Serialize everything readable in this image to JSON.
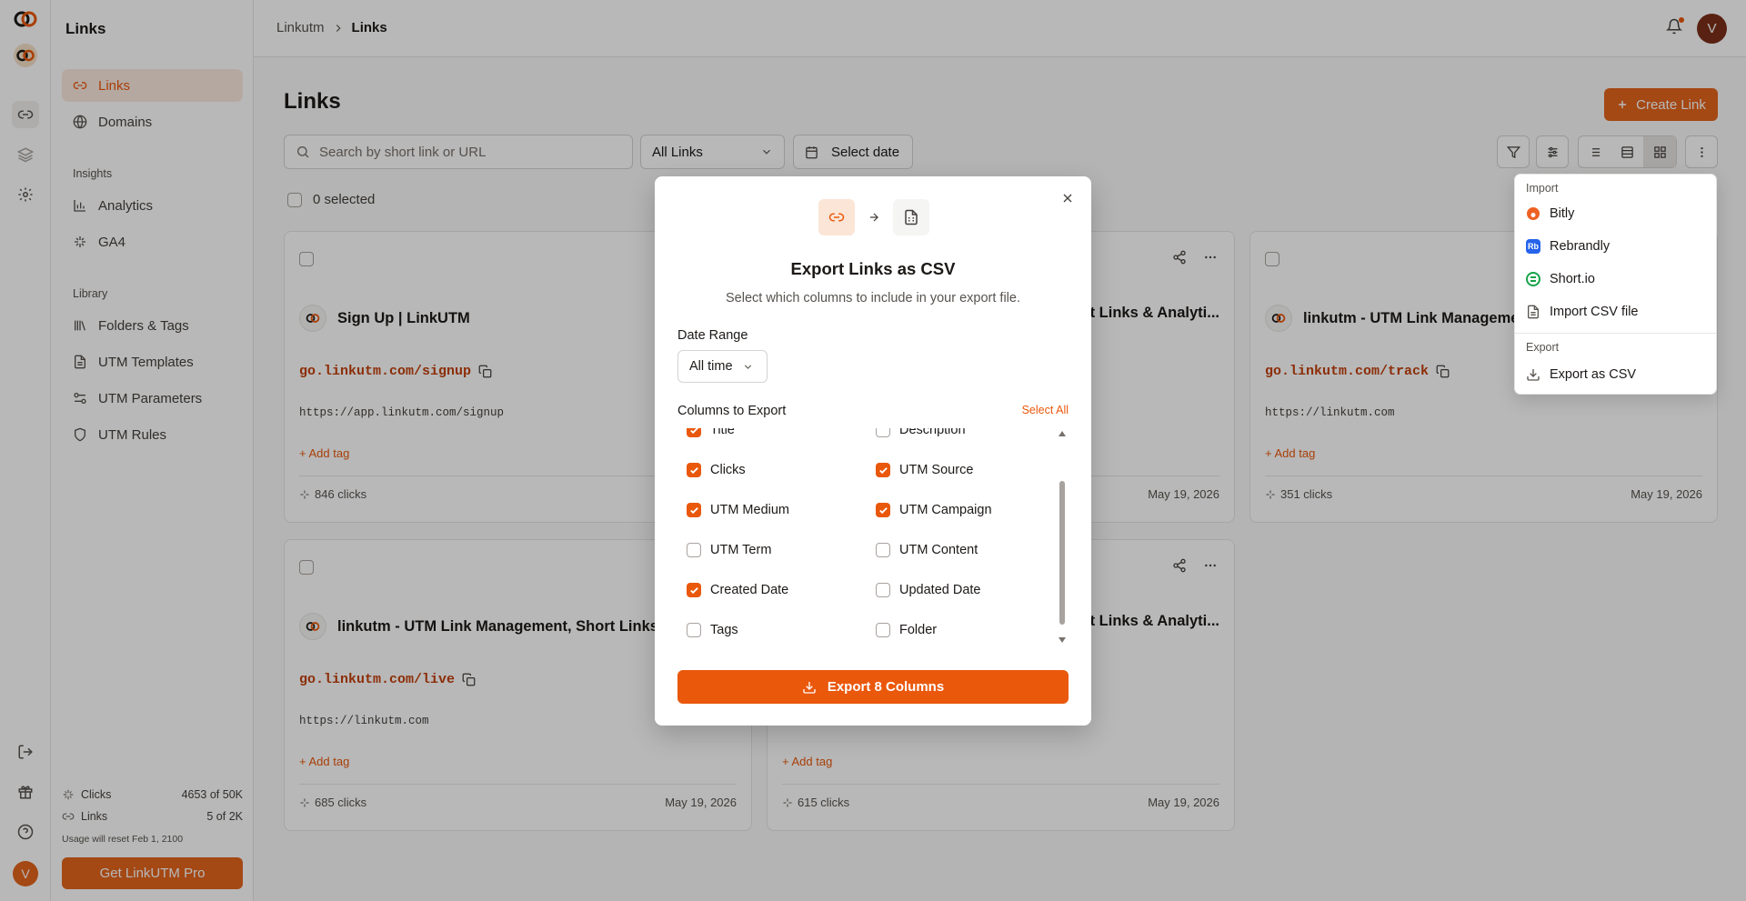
{
  "colors": {
    "accent": "#ea580c",
    "accent_button": "#e3651d",
    "avatar": "#7a2e18"
  },
  "sidebar": {
    "title": "Links",
    "items": [
      {
        "label": "Links",
        "icon": "link-icon"
      },
      {
        "label": "Domains",
        "icon": "globe-icon"
      }
    ],
    "insights_label": "Insights",
    "insights": [
      {
        "label": "Analytics",
        "icon": "bar-chart-icon"
      },
      {
        "label": "GA4",
        "icon": "sparkle-icon"
      }
    ],
    "library_label": "Library",
    "library": [
      {
        "label": "Folders & Tags",
        "icon": "library-icon"
      },
      {
        "label": "UTM Templates",
        "icon": "document-icon"
      },
      {
        "label": "UTM Parameters",
        "icon": "parameters-icon"
      },
      {
        "label": "UTM Rules",
        "icon": "shield-icon"
      }
    ],
    "usage": [
      {
        "label": "Clicks",
        "value": "4653 of 50K"
      },
      {
        "label": "Links",
        "value": "5 of 2K"
      }
    ],
    "reset_note": "Usage will reset Feb 1, 2100",
    "pro_button": "Get LinkUTM Pro"
  },
  "rail": {
    "avatar_letter": "V"
  },
  "header": {
    "breadcrumb": [
      "Linkutm",
      "Links"
    ],
    "avatar_letter": "V"
  },
  "main": {
    "title": "Links",
    "create_button": "Create Link",
    "search_placeholder": "Search by short link or URL",
    "filter_value": "All Links",
    "date_button": "Select date",
    "selected_text": "0 selected"
  },
  "cards": [
    {
      "title": "Sign Up | LinkUTM",
      "short": "go.linkutm.com/signup",
      "dest": "https://app.linkutm.com/signup",
      "add_tag": "+ Add tag",
      "clicks": "846 clicks",
      "date": ""
    },
    {
      "title": "t Links & Analyti...",
      "short": "",
      "dest": "",
      "add_tag": "",
      "clicks": "",
      "date": "May 19, 2026"
    },
    {
      "title": "linkutm - UTM Link Manageme",
      "short": "go.linkutm.com/track",
      "dest": "https://linkutm.com",
      "add_tag": "+ Add tag",
      "clicks": "351 clicks",
      "date": "May 19, 2026"
    },
    {
      "title": "linkutm - UTM Link Management, Short Links",
      "short": "go.linkutm.com/live",
      "dest": "https://linkutm.com",
      "add_tag": "+ Add tag",
      "clicks": "685 clicks",
      "date": "May 19, 2026"
    },
    {
      "title": "t Links & Analyti...",
      "short": "",
      "dest": "",
      "add_tag": "+ Add tag",
      "clicks": "615 clicks",
      "date": "May 19, 2026"
    }
  ],
  "modal": {
    "title": "Export Links as CSV",
    "subtitle": "Select which columns to include in your export file.",
    "date_range_label": "Date Range",
    "date_range_value": "All time",
    "columns_label": "Columns to Export",
    "select_all": "Select All",
    "columns": [
      {
        "label": "Title",
        "checked": true
      },
      {
        "label": "Description",
        "checked": false
      },
      {
        "label": "Clicks",
        "checked": true
      },
      {
        "label": "UTM Source",
        "checked": true
      },
      {
        "label": "UTM Medium",
        "checked": true
      },
      {
        "label": "UTM Campaign",
        "checked": true
      },
      {
        "label": "UTM Term",
        "checked": false
      },
      {
        "label": "UTM Content",
        "checked": false
      },
      {
        "label": "Created Date",
        "checked": true
      },
      {
        "label": "Updated Date",
        "checked": false
      },
      {
        "label": "Tags",
        "checked": false
      },
      {
        "label": "Folder",
        "checked": false
      }
    ],
    "export_button": "Export 8 Columns"
  },
  "menu": {
    "import_label": "Import",
    "import_items": [
      "Bitly",
      "Rebrandly",
      "Short.io",
      "Import CSV file"
    ],
    "rebrandly_badge": "Rb",
    "export_label": "Export",
    "export_items": [
      "Export as CSV"
    ]
  }
}
